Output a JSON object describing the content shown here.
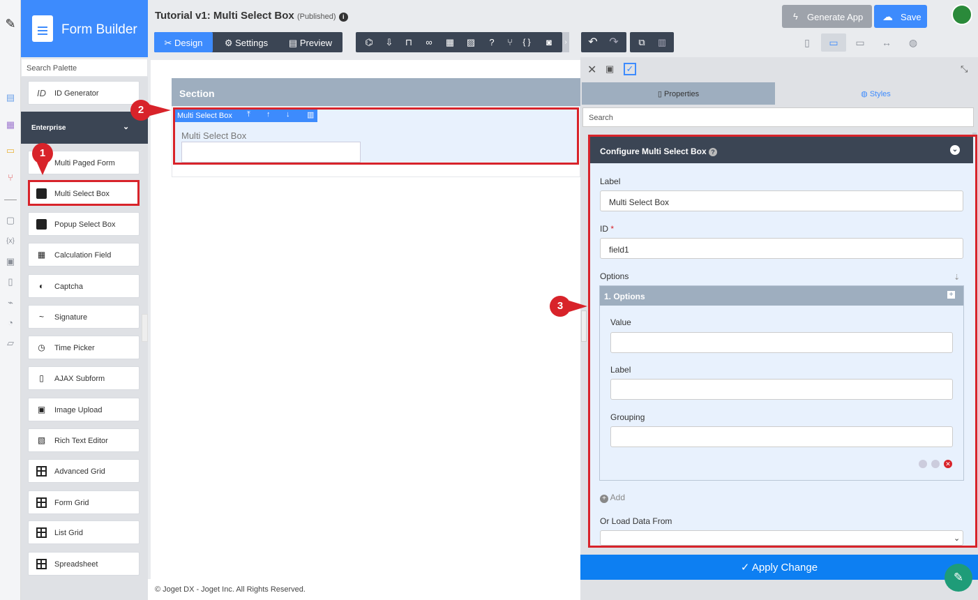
{
  "rail": {
    "icons": [
      "edit-icon",
      "form-icon",
      "list-icon",
      "userview-icon",
      "process-icon",
      "note-icon",
      "hash-variable-icon",
      "translate-icon",
      "pdf-icon",
      "plugin-icon",
      "performance-icon",
      "file-icon"
    ]
  },
  "brand": {
    "title": "Form Builder"
  },
  "palette": {
    "search_placeholder": "Search Palette",
    "top_item": "ID Generator",
    "category": "Enterprise",
    "items": [
      "Multi Paged Form",
      "Multi Select Box",
      "Popup Select Box",
      "Calculation Field",
      "Captcha",
      "Signature",
      "Time Picker",
      "AJAX Subform",
      "Image Upload",
      "Rich Text Editor",
      "Advanced Grid",
      "Form Grid",
      "List Grid",
      "Spreadsheet"
    ]
  },
  "header": {
    "title": "Tutorial v1: Multi Select Box",
    "status": "(Published)",
    "tabs": [
      "Design",
      "Settings",
      "Preview"
    ],
    "generate_app": "Generate App",
    "save": "Save"
  },
  "canvas": {
    "section_title": "Section",
    "element_name": "Multi Select Box",
    "field_label": "Multi Select Box",
    "footer": "© Joget DX - Joget Inc. All Rights Reserved."
  },
  "properties": {
    "tab_properties": "Properties",
    "tab_styles": "Styles",
    "search_placeholder": "Search",
    "config_title": "Configure Multi Select Box",
    "label_label": "Label",
    "label_value": "Multi Select Box",
    "id_label": "ID",
    "id_required": "*",
    "id_value": "field1",
    "options_label": "Options",
    "options_group": "1. Options",
    "value_label": "Value",
    "option_label_label": "Label",
    "grouping_label": "Grouping",
    "add_label": "Add",
    "load_from": "Or Load Data From",
    "apply": "Apply Change"
  },
  "markers": [
    "1",
    "2",
    "3"
  ],
  "colors": {
    "accent": "#3d8bfd",
    "highlight": "#d8232a",
    "dark": "#3b4554",
    "apply": "#0d7ff2"
  }
}
